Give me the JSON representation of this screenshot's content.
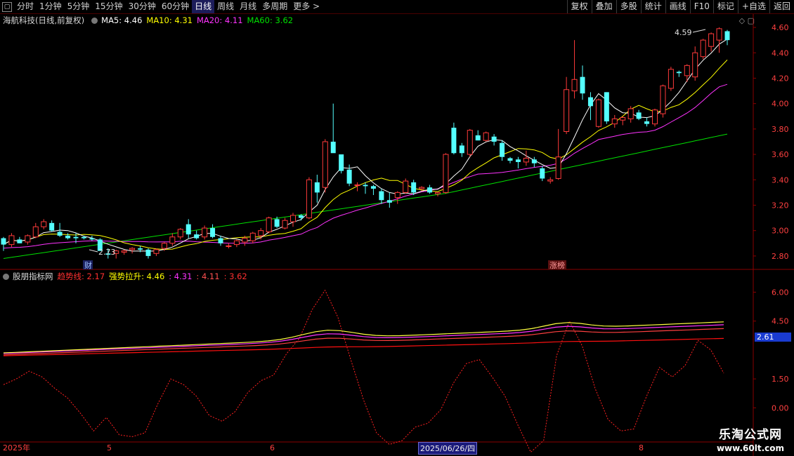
{
  "toolbar": {
    "periods": [
      "分时",
      "1分钟",
      "5分钟",
      "15分钟",
      "30分钟",
      "60分钟",
      "日线",
      "周线",
      "月线",
      "多周期",
      "更多"
    ],
    "active_period": "日线",
    "right_buttons": [
      "复权",
      "叠加",
      "多股",
      "统计",
      "画线",
      "F10",
      "标记",
      "+自选",
      "返回"
    ]
  },
  "main_legend": {
    "title": "海航科技(日线,前复权)",
    "ma5": "MA5: 4.46",
    "ma10": "MA10: 4.31",
    "ma20": "MA20: 4.11",
    "ma60": "MA60: 3.62"
  },
  "sub_legend": {
    "title": "股朋指标网",
    "trend_label": "趋势线: 2.17",
    "strong_label": "强势拉升: 4.46",
    "v2": ": 4.31",
    "v3": ": 4.11",
    "v4": ": 3.62"
  },
  "price_axis": [
    "4.60",
    "4.40",
    "4.20",
    "4.00",
    "3.80",
    "3.60",
    "3.40",
    "3.20",
    "3.00",
    "2.80"
  ],
  "sub_axis": [
    "6.00",
    "4.50",
    "1.50",
    "0.00"
  ],
  "sub_axis_marker": "2.61",
  "annotations": {
    "high": "4.59",
    "low": "2.73",
    "cai": "财",
    "zhangting": "涨榜"
  },
  "date_axis": {
    "year": "2025年",
    "m5": "5",
    "m6": "6",
    "cursor_date": "2025/06/26/四",
    "m8": "8"
  },
  "watermark": {
    "line1": "乐淘公式网",
    "line2": "www.60lt.com"
  },
  "colors": {
    "up": "#ff3a3a",
    "down": "#54ffff",
    "ma5": "#ffffff",
    "ma10": "#ffff00",
    "ma20": "#ff33ff",
    "ma60": "#00e000"
  },
  "chart_data": {
    "type": "candlestick",
    "title": "海航科技(日线,前复权)",
    "y_range": [
      2.7,
      4.65
    ],
    "candles_ohlc": [
      [
        2.94,
        2.95,
        2.84,
        2.89
      ],
      [
        2.89,
        2.98,
        2.87,
        2.96
      ],
      [
        2.93,
        2.95,
        2.9,
        2.9
      ],
      [
        2.91,
        2.97,
        2.89,
        2.96
      ],
      [
        2.95,
        3.06,
        2.94,
        3.03
      ],
      [
        3.03,
        3.09,
        3.01,
        3.07
      ],
      [
        3.06,
        3.08,
        2.99,
        3.0
      ],
      [
        2.99,
        3.06,
        2.95,
        2.96
      ],
      [
        2.96,
        2.98,
        2.93,
        2.94
      ],
      [
        2.95,
        2.98,
        2.9,
        2.94
      ],
      [
        2.95,
        2.96,
        2.93,
        2.94
      ],
      [
        2.94,
        2.96,
        2.92,
        2.93
      ],
      [
        2.93,
        2.94,
        2.84,
        2.84
      ],
      [
        2.82,
        2.86,
        2.78,
        2.81
      ],
      [
        2.82,
        2.85,
        2.78,
        2.84
      ],
      [
        2.83,
        2.85,
        2.81,
        2.84
      ],
      [
        2.85,
        2.87,
        2.82,
        2.86
      ],
      [
        2.86,
        2.88,
        2.83,
        2.85
      ],
      [
        2.85,
        2.86,
        2.78,
        2.8
      ],
      [
        2.82,
        2.86,
        2.8,
        2.85
      ],
      [
        2.86,
        2.91,
        2.84,
        2.9
      ],
      [
        2.9,
        2.98,
        2.88,
        2.95
      ],
      [
        2.95,
        3.02,
        2.93,
        3.01
      ],
      [
        3.05,
        3.09,
        2.94,
        2.97
      ],
      [
        2.97,
        3.0,
        2.93,
        2.94
      ],
      [
        2.95,
        3.04,
        2.93,
        3.02
      ],
      [
        3.02,
        3.05,
        2.94,
        2.95
      ],
      [
        2.94,
        2.96,
        2.88,
        2.9
      ],
      [
        2.88,
        2.9,
        2.86,
        2.88
      ],
      [
        2.89,
        2.93,
        2.87,
        2.92
      ],
      [
        2.91,
        2.96,
        2.88,
        2.94
      ],
      [
        2.92,
        2.99,
        2.9,
        2.98
      ],
      [
        2.96,
        3.02,
        2.93,
        3.0
      ],
      [
        2.99,
        3.11,
        2.98,
        3.1
      ],
      [
        3.09,
        3.11,
        3.02,
        3.03
      ],
      [
        3.02,
        3.1,
        3.01,
        3.08
      ],
      [
        3.07,
        3.14,
        3.03,
        3.12
      ],
      [
        3.12,
        3.13,
        3.08,
        3.1
      ],
      [
        3.1,
        3.42,
        3.09,
        3.4
      ],
      [
        3.38,
        3.44,
        3.22,
        3.3
      ],
      [
        3.34,
        3.72,
        3.3,
        3.7
      ],
      [
        3.7,
        4.0,
        3.65,
        3.61
      ],
      [
        3.6,
        3.53,
        3.45,
        3.47
      ],
      [
        3.48,
        3.52,
        3.35,
        3.37
      ],
      [
        3.36,
        3.38,
        3.31,
        3.36
      ],
      [
        3.36,
        3.38,
        3.29,
        3.35
      ],
      [
        3.35,
        3.36,
        3.28,
        3.33
      ],
      [
        3.31,
        3.33,
        3.21,
        3.24
      ],
      [
        3.24,
        3.3,
        3.18,
        3.22
      ],
      [
        3.26,
        3.31,
        3.21,
        3.3
      ],
      [
        3.3,
        3.41,
        3.29,
        3.39
      ],
      [
        3.38,
        3.4,
        3.28,
        3.3
      ],
      [
        3.33,
        3.35,
        3.31,
        3.34
      ],
      [
        3.34,
        3.36,
        3.29,
        3.3
      ],
      [
        3.29,
        3.3,
        3.27,
        3.3
      ],
      [
        3.3,
        3.61,
        3.29,
        3.6
      ],
      [
        3.81,
        3.85,
        3.6,
        3.61
      ],
      [
        3.67,
        3.69,
        3.58,
        3.61
      ],
      [
        3.6,
        3.8,
        3.58,
        3.79
      ],
      [
        3.75,
        3.79,
        3.71,
        3.71
      ],
      [
        3.71,
        3.78,
        3.7,
        3.77
      ],
      [
        3.74,
        3.76,
        3.67,
        3.7
      ],
      [
        3.69,
        3.71,
        3.55,
        3.58
      ],
      [
        3.57,
        3.58,
        3.53,
        3.55
      ],
      [
        3.56,
        3.58,
        3.49,
        3.54
      ],
      [
        3.54,
        3.63,
        3.51,
        3.57
      ],
      [
        3.56,
        3.58,
        3.5,
        3.53
      ],
      [
        3.49,
        3.51,
        3.39,
        3.41
      ],
      [
        3.39,
        3.42,
        3.37,
        3.4
      ],
      [
        3.41,
        3.8,
        3.4,
        3.58
      ],
      [
        3.78,
        4.21,
        3.76,
        4.11
      ],
      [
        4.1,
        4.5,
        4.04,
        4.19
      ],
      [
        4.21,
        4.3,
        4.03,
        4.08
      ],
      [
        4.05,
        4.09,
        3.87,
        3.98
      ],
      [
        3.82,
        4.04,
        3.81,
        4.03
      ],
      [
        4.09,
        4.09,
        3.84,
        3.86
      ],
      [
        3.84,
        3.91,
        3.81,
        3.88
      ],
      [
        3.87,
        3.9,
        3.83,
        3.89
      ],
      [
        3.88,
        3.98,
        3.85,
        3.96
      ],
      [
        3.93,
        3.95,
        3.87,
        3.88
      ],
      [
        3.86,
        3.89,
        3.82,
        3.84
      ],
      [
        3.84,
        3.96,
        3.82,
        3.95
      ],
      [
        3.92,
        4.15,
        3.89,
        4.14
      ],
      [
        4.12,
        4.29,
        4.1,
        4.27
      ],
      [
        4.25,
        4.26,
        4.21,
        4.24
      ],
      [
        4.22,
        4.31,
        4.17,
        4.3
      ],
      [
        4.21,
        4.45,
        4.18,
        4.4
      ],
      [
        4.37,
        4.51,
        4.35,
        4.5
      ],
      [
        4.45,
        4.56,
        4.41,
        4.55
      ],
      [
        4.5,
        4.6,
        4.4,
        4.59
      ],
      [
        4.57,
        4.58,
        4.46,
        4.5
      ]
    ],
    "ma_series": [
      {
        "name": "MA5",
        "last": 4.46
      },
      {
        "name": "MA10",
        "last": 4.31
      },
      {
        "name": "MA20",
        "last": 4.11
      },
      {
        "name": "MA60",
        "last": 3.62
      }
    ],
    "sub_y_range": [
      -1.7,
      6.6
    ],
    "sub_series": [
      {
        "name": "趋势线",
        "last": 2.17
      },
      {
        "name": "强势拉升",
        "last": 4.46
      }
    ],
    "trend_line": [
      1.2,
      1.5,
      1.9,
      1.6,
      1.0,
      0.5,
      -0.3,
      -1.2,
      -0.5,
      -1.4,
      -1.5,
      -1.3,
      0.2,
      1.5,
      1.2,
      0.6,
      -0.4,
      -0.7,
      -0.2,
      0.8,
      1.4,
      1.7,
      2.8,
      3.6,
      5.1,
      6.1,
      4.7,
      2.5,
      0.4,
      -1.3,
      -1.9,
      -1.7,
      -1.0,
      -0.8,
      -0.1,
      1.3,
      2.3,
      2.5,
      1.6,
      0.6,
      -0.9,
      -2.3,
      -1.7,
      2.7,
      4.5,
      3.2,
      1.0,
      -0.6,
      -1.2,
      -1.1,
      0.6,
      2.1,
      1.6,
      2.2,
      3.5,
      3.0,
      1.8
    ]
  }
}
